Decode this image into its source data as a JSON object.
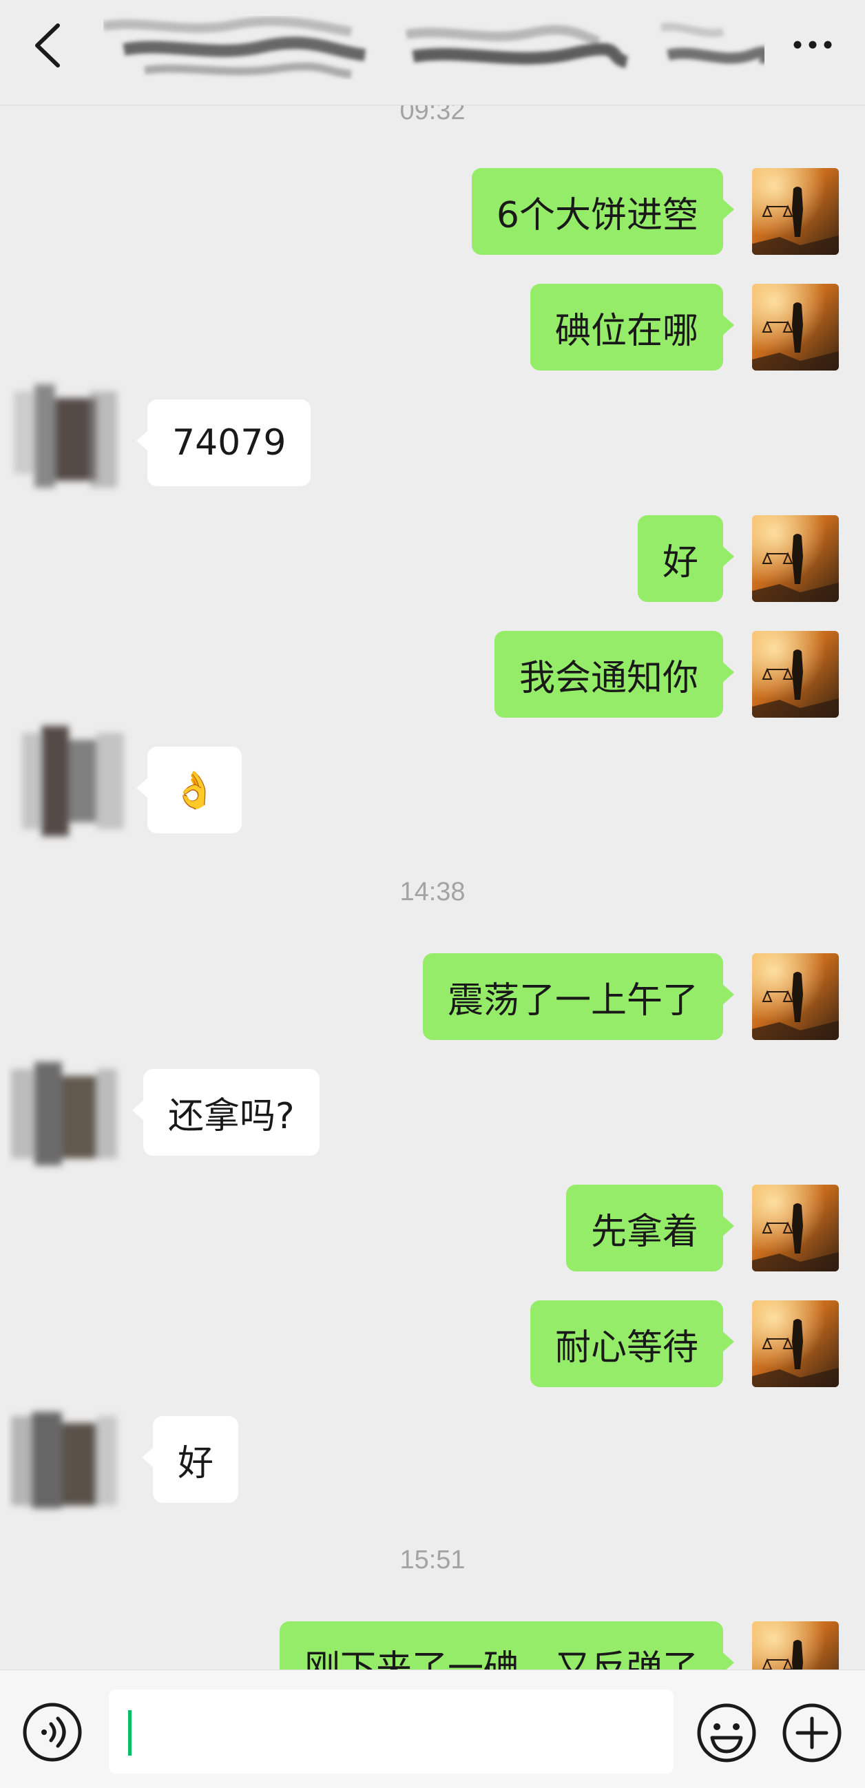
{
  "header": {
    "back_icon": "chevron-left-icon",
    "more_icon": "ellipsis-icon"
  },
  "timestamps": [
    "09:32",
    "14:38",
    "15:51"
  ],
  "messages": [
    {
      "side": "me",
      "text": "6个大饼进箜"
    },
    {
      "side": "me",
      "text": "碘位在哪"
    },
    {
      "side": "them",
      "text": "74079"
    },
    {
      "side": "me",
      "text": "好"
    },
    {
      "side": "me",
      "text": "我会通知你"
    },
    {
      "side": "them",
      "text": "👌"
    },
    {
      "side": "me",
      "text": "震荡了一上午了"
    },
    {
      "side": "them",
      "text": "还拿吗?"
    },
    {
      "side": "me",
      "text": "先拿着"
    },
    {
      "side": "me",
      "text": "耐心等待"
    },
    {
      "side": "them",
      "text": "好"
    },
    {
      "side": "me",
      "text": "刚下来了一碘，又反弹了"
    }
  ],
  "footer": {
    "input_value": "",
    "voice_icon": "voice-icon",
    "emoji_icon": "emoji-icon",
    "plus_icon": "plus-icon"
  },
  "colors": {
    "background": "#ededed",
    "my_bubble": "#95ec69",
    "their_bubble": "#ffffff",
    "caret": "#07c160"
  }
}
